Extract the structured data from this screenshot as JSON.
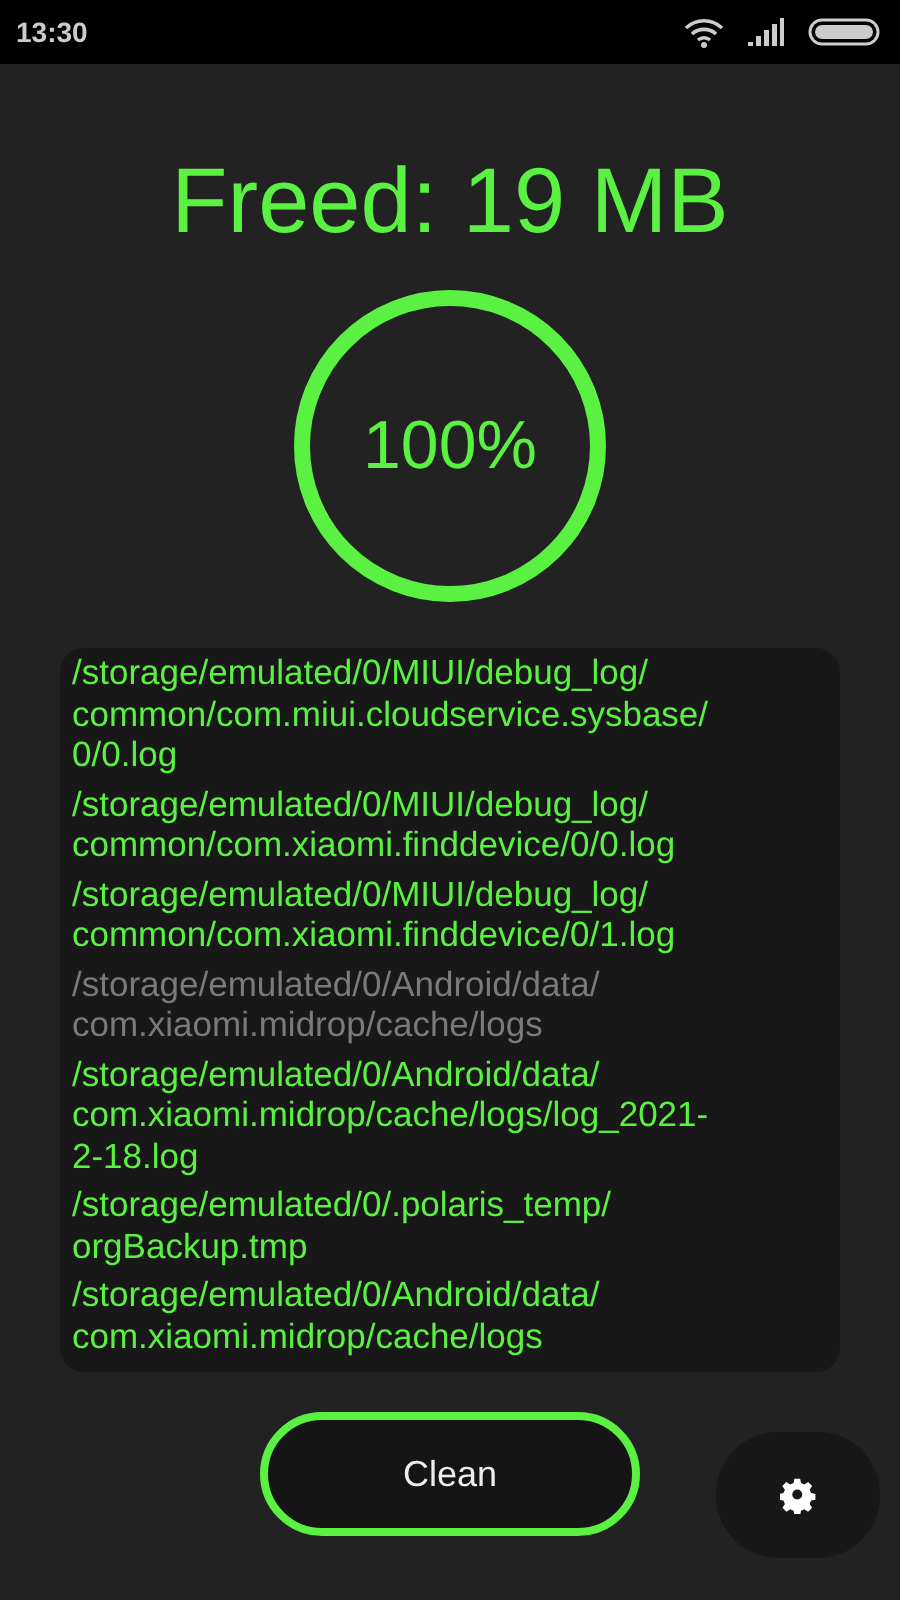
{
  "status_bar": {
    "time": "13:30"
  },
  "title": "Freed: 19 MB",
  "progress": {
    "level": 1,
    "label": "100%"
  },
  "files": [
    {
      "path": "/storage/emulated/0/MIUI/debug_log/common/com.miui.cloudservice.sysbase/0/0.log",
      "cleaned": true
    },
    {
      "path": "/storage/emulated/0/MIUI/debug_log/common/com.xiaomi.finddevice/0/0.log",
      "cleaned": true
    },
    {
      "path": "/storage/emulated/0/MIUI/debug_log/common/com.xiaomi.finddevice/0/1.log",
      "cleaned": true
    },
    {
      "path": "/storage/emulated/0/Android/data/com.xiaomi.midrop/cache/logs",
      "cleaned": false
    },
    {
      "path": "/storage/emulated/0/Android/data/com.xiaomi.midrop/cache/logs/log_2021-2-18.log",
      "cleaned": true
    },
    {
      "path": "/storage/emulated/0/.polaris_temp/orgBackup.tmp",
      "cleaned": true
    },
    {
      "path": "/storage/emulated/0/Android/data/com.xiaomi.midrop/cache/logs",
      "cleaned": true
    }
  ],
  "buttons": {
    "clean": "Clean"
  }
}
